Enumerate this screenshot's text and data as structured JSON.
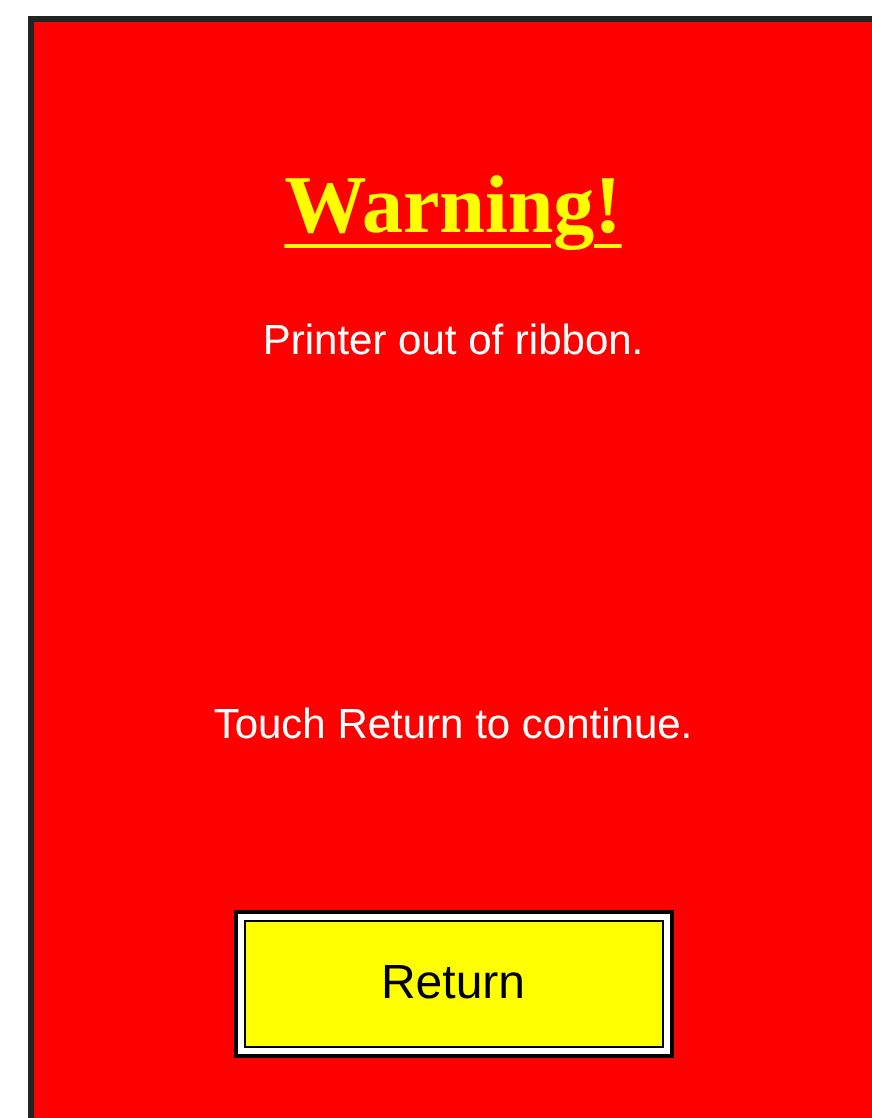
{
  "title": "Warning!",
  "message": "Printer out of ribbon.",
  "instruction": "Touch Return to continue.",
  "button": "Return"
}
